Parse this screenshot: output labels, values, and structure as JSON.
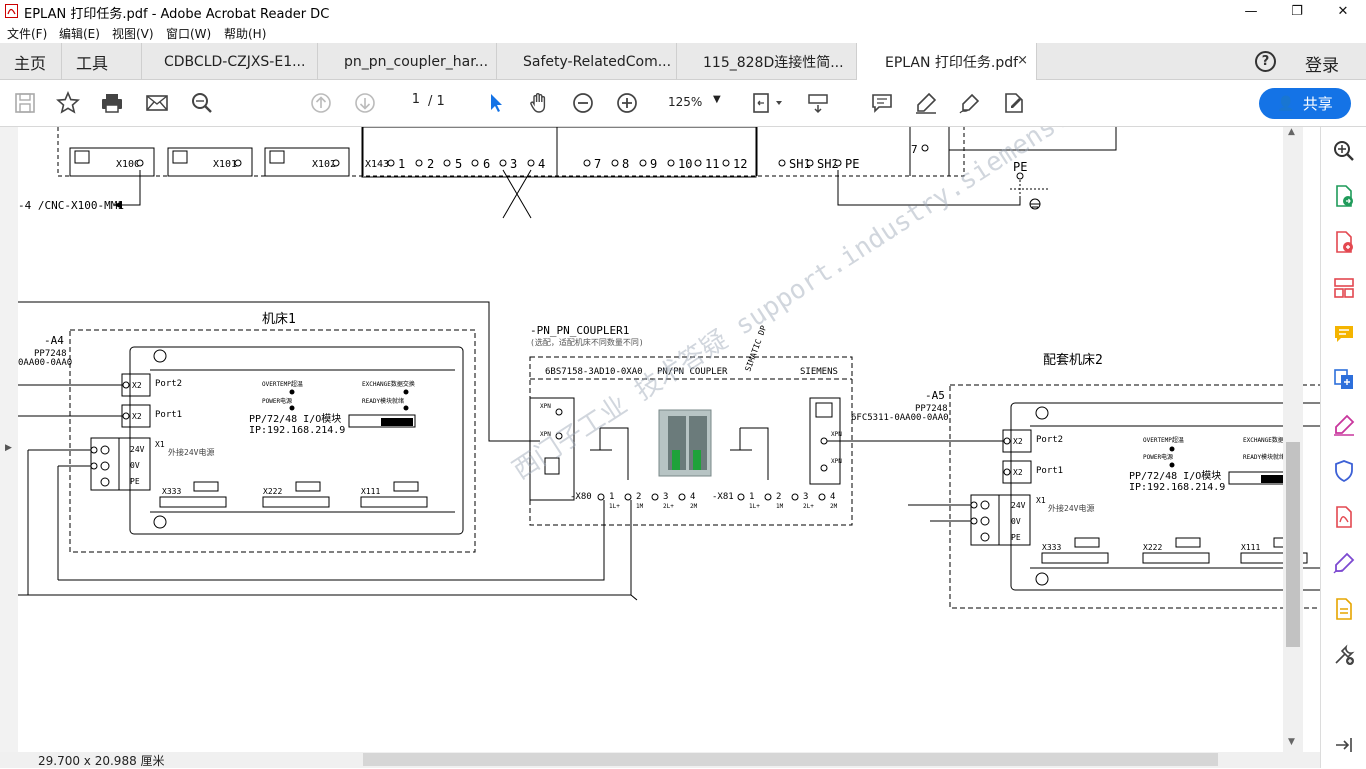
{
  "window": {
    "title": "EPLAN 打印任务.pdf - Adobe Acrobat Reader DC",
    "minimize": "—",
    "restore": "❐",
    "close": "✕"
  },
  "menu": [
    "文件(F)",
    "编辑(E)",
    "视图(V)",
    "窗口(W)",
    "帮助(H)"
  ],
  "tabs": {
    "home": "主页",
    "tools": "工具",
    "documents": [
      {
        "label": "CDBCLD-CZJXS-E1..."
      },
      {
        "label": "pn_pn_coupler_har..."
      },
      {
        "label": "Safety-RelatedCom..."
      },
      {
        "label": "115_828D连接性简..."
      },
      {
        "label": "EPLAN 打印任务.pdf",
        "active": true
      }
    ],
    "close_symbol": "×",
    "help": "?",
    "login": "登录"
  },
  "toolbar": {
    "page_current": "1",
    "page_total": "/ 1",
    "zoom": "125%",
    "share": "共享"
  },
  "status": {
    "dimensions": "29.700 x 20.988 厘米"
  },
  "drawing": {
    "top_connectors": [
      "X100",
      "X101",
      "X102"
    ],
    "x143_label": "X143",
    "x143_terminals": [
      "1",
      "2",
      "5",
      "6",
      "3",
      "4",
      "7",
      "8",
      "9",
      "10",
      "11",
      "12"
    ],
    "shield_labels": [
      "SH1",
      "SH2",
      "PE"
    ],
    "terminal_7": "7",
    "pe_label": "PE",
    "cnc_ref": "-4 /CNC-X100-MM1",
    "machine1": {
      "title": "机床1",
      "tag": "-A4",
      "model": "PP7248",
      "part": "0AA00-0AA0",
      "port2": "Port2",
      "port1": "Port1",
      "x2": "X2",
      "x1": "X1",
      "v24": "24V",
      "v0": "0V",
      "pe": "PE",
      "ext_power": "外接24V电源",
      "overtemp": "OVERTEMP超温",
      "power": "POWER电源",
      "exchange": "EXCHANGE数据交换",
      "ready": "READY模块就绪",
      "module": "PP/72/48 I/O模块",
      "ip": "IP:192.168.214.9",
      "x333": "X333",
      "x222": "X222",
      "x111": "X111"
    },
    "coupler": {
      "tag": "-PN_PN_COUPLER1",
      "note": "(选配，适配机床不同数量不同)",
      "order": "6BS7158-3AD10-0XA0",
      "name": "PN/PN COUPLER",
      "vendor": "SIEMENS",
      "simatic": "SIMATIC DP",
      "x80": "-X80",
      "x81": "-X81",
      "pins": [
        "1",
        "2",
        "3",
        "4"
      ],
      "pin_labels": [
        "1L+",
        "1M",
        "2L+",
        "2M"
      ],
      "xpn": "XPN"
    },
    "machine2": {
      "title": "配套机床2",
      "tag": "-A5",
      "model": "PP7248",
      "part": "6FC5311-0AA00-0AA0",
      "port2": "Port2",
      "port1": "Port1",
      "x2": "X2",
      "x1": "X1",
      "v24": "24V",
      "v0": "0V",
      "pe": "PE",
      "ext_power": "外接24V电源",
      "overtemp": "OVERTEMP超温",
      "power": "POWER电源",
      "exchange": "EXCHANGE数据交换",
      "ready": "READY模块就绪",
      "module": "PP/72/48 I/O模块",
      "ip": "IP:192.168.214.9",
      "x333": "X333",
      "x222": "X222",
      "x111": "X111"
    },
    "watermark": "西门子工业 技术答疑 support.industry.siemens.com/cs"
  }
}
